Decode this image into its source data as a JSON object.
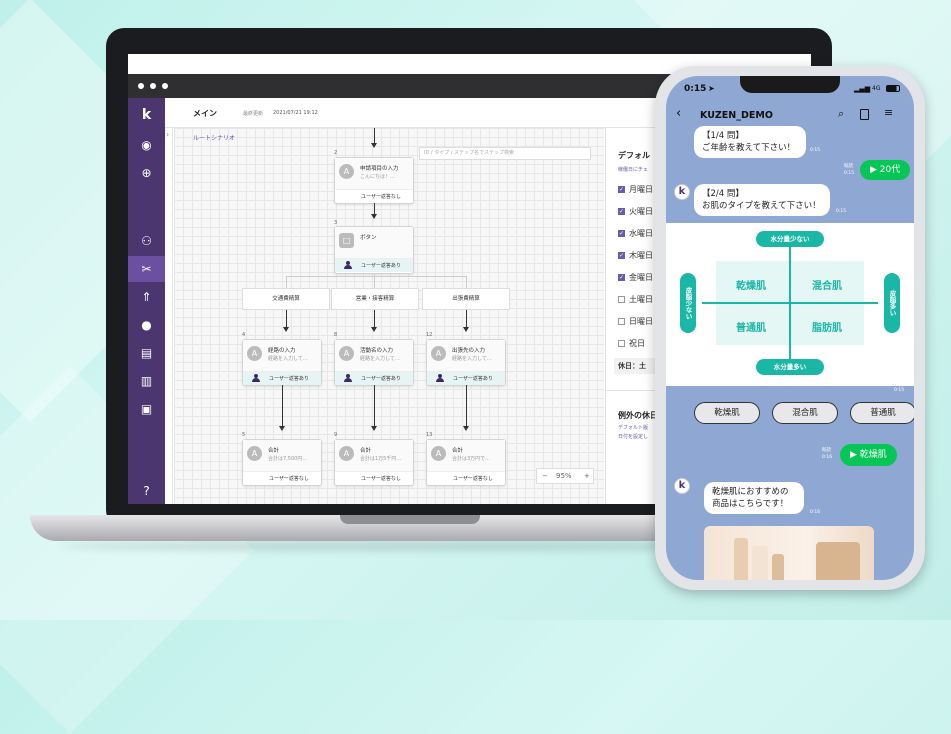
{
  "app": {
    "header_title": "メイン",
    "last_updated_label": "最終更新",
    "last_updated": "2021/07/21 19:12",
    "breadcrumb": "ルートシナリオ",
    "search_placeholder": "ID / タイプ / ステップ名でステップ検索",
    "zoom": "95%",
    "zoom_minus": "−",
    "zoom_plus": "+",
    "nodes": [
      {
        "num": "2",
        "title": "申請項目の入力",
        "sub": "こんにちは！…",
        "status": "ユーザー返答なし"
      },
      {
        "num": "3",
        "title": "ボタン",
        "sub": "",
        "status": "ユーザー返答あり"
      },
      {
        "num": "4",
        "title": "経路の入力",
        "sub": "経路を入力して…",
        "status": "ユーザー返答あり"
      },
      {
        "num": "8",
        "title": "活動名の入力",
        "sub": "経路を入力して…",
        "status": "ユーザー返答あり"
      },
      {
        "num": "12",
        "title": "出張先の入力",
        "sub": "経路を入力して…",
        "status": "ユーザー返答あり"
      },
      {
        "num": "5",
        "title": "合計",
        "sub": "合計は7,500円…",
        "status": "ユーザー返答なし"
      },
      {
        "num": "9",
        "title": "合計",
        "sub": "合計は1万5千円…",
        "status": "ユーザー返答なし"
      },
      {
        "num": "13",
        "title": "合計",
        "sub": "合計は3万円で…",
        "status": "ユーザー返答なし"
      }
    ],
    "branches": [
      "交通費精算",
      "営業・接客精算",
      "出張費精算"
    ],
    "panel": {
      "title": "デフォル",
      "sub": "稼働日にチェ",
      "days": [
        {
          "label": "月曜日",
          "checked": true
        },
        {
          "label": "火曜日",
          "checked": true
        },
        {
          "label": "水曜日",
          "checked": true
        },
        {
          "label": "木曜日",
          "checked": true
        },
        {
          "label": "金曜日",
          "checked": true
        },
        {
          "label": "土曜日",
          "checked": false
        },
        {
          "label": "日曜日",
          "checked": false
        },
        {
          "label": "祝日",
          "checked": false
        }
      ],
      "holiday": "休日：土",
      "exceptions_title": "例外の休日",
      "exceptions_sub1": "デフォルト版",
      "exceptions_sub2": "日付を設定し"
    }
  },
  "phone": {
    "time": "0:15",
    "signal": "4G",
    "chat_title": "KUZEN_DEMO",
    "messages": {
      "q1_line1": "【1/4 問】",
      "q1_line2": "ご年齢を教えて下さい！",
      "q1_time": "0:15",
      "a1": "▶ 20代",
      "a1_read": "既読",
      "a1_time": "0:15",
      "q2_line1": "【2/4 問】",
      "q2_line2": "お肌のタイプを教えて下さい！",
      "q2_time": "0:15",
      "img_time": "0:15",
      "a2": "▶ 乾燥肌",
      "a2_read": "既読",
      "a2_time": "0:16",
      "q3_line1": "乾燥肌におすすめの",
      "q3_line2": "商品はこちらです！",
      "q3_time": "0:16"
    },
    "skin_chart": {
      "top": "水分量少ない",
      "bottom": "水分量多い",
      "left": "皮脂少ない",
      "right": "皮脂多い",
      "q_tl": "乾燥肌",
      "q_tr": "混合肌",
      "q_bl": "普通肌",
      "q_br": "脂肪肌"
    },
    "quick_replies": [
      "乾燥肌",
      "混合肌",
      "普通肌"
    ],
    "avatar_letter": "k"
  },
  "colors": {
    "sidebar": "#4b3670",
    "line_green": "#06c755",
    "teal": "#1bb7a6",
    "chat_bg": "#8fa7d3"
  }
}
